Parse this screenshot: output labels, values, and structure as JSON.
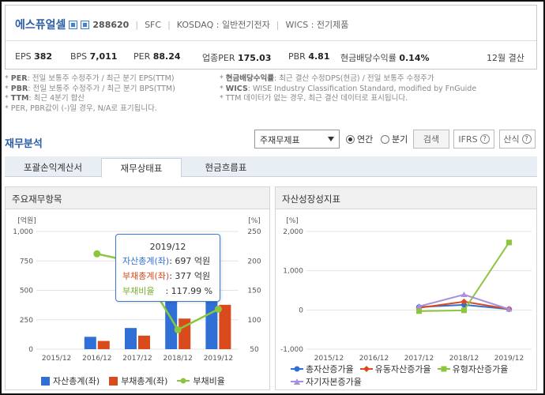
{
  "company": {
    "name": "에스퓨얼셀",
    "code": "288620",
    "type": "SFC",
    "market": "KOSDAQ : 일반전기전자",
    "wics": "WICS : 전기제품"
  },
  "metrics": {
    "eps_label": "EPS",
    "eps": "382",
    "bps_label": "BPS",
    "bps": "7,011",
    "per_label": "PER",
    "per": "88.24",
    "ind_per_label": "업종PER",
    "ind_per": "175.03",
    "pbr_label": "PBR",
    "pbr": "4.81",
    "div_label": "현금배당수익률",
    "div": "0.14%",
    "fiscal": "12월 결산"
  },
  "notes": {
    "l1_key": "PER",
    "l1": ": 전일 보통주 수정주가 / 최근 분기 EPS(TTM)",
    "l2_key": "PBR",
    "l2": ": 전일 보통주 수정주가 / 최근 분기 BPS(TTM)",
    "l3_key": "TTM",
    "l3": ": 최근 4분기 합산",
    "l4": "* PER, PBR값이 (-)일 경우, N/A로 표기됩니다.",
    "r1_key": "현금배당수익률",
    "r1": ": 최근 결산 수정DPS(현금) / 전일 보통주 수정주가",
    "r2_key": "WICS",
    "r2": ": WISE Industry Classification Standard, modified by FnGuide",
    "r3": "* TTM 데이터가 없는 경우, 최근 결산 데이터로 표시됩니다."
  },
  "section_title": "재무분석",
  "controls": {
    "select_value": "주재무제표",
    "radio_annual": "연간",
    "radio_quarter": "분기",
    "search": "검색",
    "ifrs": "IFRS",
    "formula": "산식",
    "qmark": "?"
  },
  "tabs": [
    "포괄손익계산서",
    "재무상태표",
    "현금흐름표"
  ],
  "left_panel_title": "주요재무항목",
  "right_panel_title": "자산성장성지표",
  "tooltip": {
    "title": "2019/12",
    "r1_label": "자산총계(좌)",
    "r1_value": ": 697 억원",
    "r2_label": "부채총계(좌)",
    "r2_value": ": 377 억원",
    "r3_label": "부채비율",
    "r3_value": ": 117.99 %"
  },
  "colors": {
    "blue": "#2f6fd6",
    "red": "#d94a1c",
    "green": "#8cc63f",
    "purple": "#a98fdc",
    "accent": "#2b5ea7"
  },
  "chart_data": [
    {
      "type": "bar",
      "categories": [
        "2015/12",
        "2016/12",
        "2017/12",
        "2018/12",
        "2019/12"
      ],
      "left_unit": "[억원]",
      "right_unit": "[%]",
      "ylim": [
        0,
        1000
      ],
      "y2lim": [
        50,
        250
      ],
      "left_ticks": [
        "1,000",
        "750",
        "500",
        "250",
        "0"
      ],
      "right_ticks": [
        "250",
        "200",
        "150",
        "100",
        "50"
      ],
      "series": [
        {
          "name": "자산총계(좌)",
          "kind": "bar",
          "axis": "left",
          "values": [
            null,
            105,
            180,
            410,
            697
          ]
        },
        {
          "name": "부채총계(좌)",
          "kind": "bar",
          "axis": "left",
          "values": [
            null,
            70,
            115,
            260,
            377
          ]
        },
        {
          "name": "부채비율",
          "kind": "line",
          "axis": "right",
          "values": [
            null,
            212,
            197,
            83,
            117.99
          ]
        }
      ]
    },
    {
      "type": "line",
      "categories": [
        "2015/12",
        "2016/12",
        "2017/12",
        "2018/12",
        "2019/12"
      ],
      "unit": "[%]",
      "ylim": [
        -1000,
        2000
      ],
      "ticks": [
        "2,000",
        "1,000",
        "0",
        "-1,000"
      ],
      "series": [
        {
          "name": "총자산증가율",
          "values": [
            null,
            null,
            75,
            130,
            20
          ]
        },
        {
          "name": "유동자산증가율",
          "values": [
            null,
            null,
            55,
            210,
            25
          ]
        },
        {
          "name": "유형자산증가율",
          "values": [
            null,
            null,
            -30,
            -10,
            1720
          ]
        },
        {
          "name": "자기자본증가율",
          "values": [
            null,
            null,
            90,
            390,
            20
          ]
        }
      ]
    }
  ]
}
